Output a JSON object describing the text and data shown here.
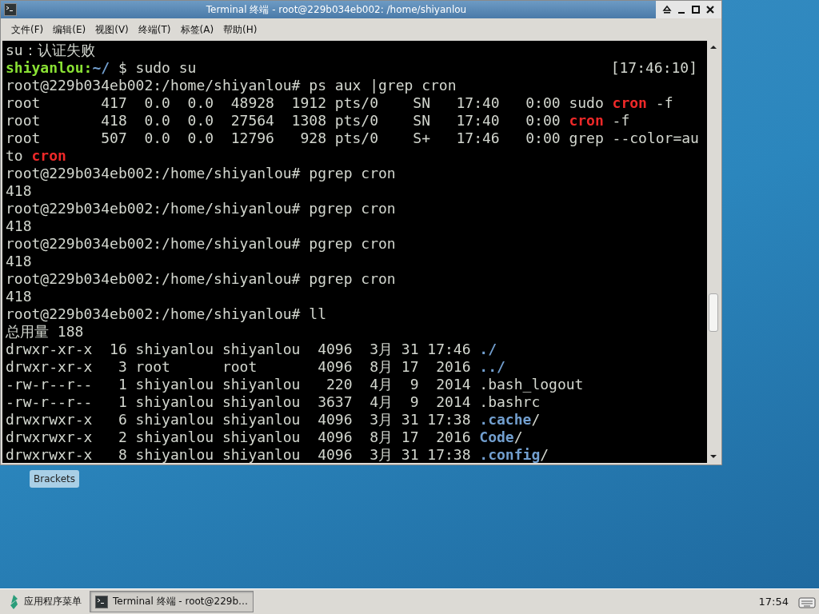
{
  "window": {
    "title": "Terminal 终端 - root@229b034eb002: /home/shiyanlou"
  },
  "menu": [
    "文件(F)",
    "编辑(E)",
    "视图(V)",
    "终端(T)",
    "标签(A)",
    "帮助(H)"
  ],
  "terminal": {
    "lines": [
      {
        "segments": [
          {
            "text": "su：认证失败",
            "kind": "plain"
          }
        ]
      },
      {
        "segments": [
          {
            "text": "shiyanlou:",
            "kind": "user"
          },
          {
            "text": "~/",
            "kind": "path"
          },
          {
            "text": " $ sudo su",
            "kind": "plain"
          }
        ],
        "right": "[17:46:10]"
      },
      {
        "segments": [
          {
            "text": "root@229b034eb002:/home/shiyanlou# ps aux |grep cron",
            "kind": "plain"
          }
        ]
      },
      {
        "segments": [
          {
            "text": "root       417  0.0  0.0  48928  1912 pts/0    SN   17:40   0:00 sudo ",
            "kind": "plain"
          },
          {
            "text": "cron",
            "kind": "match"
          },
          {
            "text": " -f",
            "kind": "plain"
          }
        ]
      },
      {
        "segments": [
          {
            "text": "root       418  0.0  0.0  27564  1308 pts/0    SN   17:40   0:00 ",
            "kind": "plain"
          },
          {
            "text": "cron",
            "kind": "match"
          },
          {
            "text": " -f",
            "kind": "plain"
          }
        ]
      },
      {
        "segments": [
          {
            "text": "root       507  0.0  0.0  12796   928 pts/0    S+   17:46   0:00 grep --color=au",
            "kind": "plain"
          }
        ]
      },
      {
        "segments": [
          {
            "text": "to ",
            "kind": "plain"
          },
          {
            "text": "cron",
            "kind": "match"
          }
        ]
      },
      {
        "segments": [
          {
            "text": "root@229b034eb002:/home/shiyanlou# pgrep cron",
            "kind": "plain"
          }
        ]
      },
      {
        "segments": [
          {
            "text": "418",
            "kind": "plain"
          }
        ]
      },
      {
        "segments": [
          {
            "text": "root@229b034eb002:/home/shiyanlou# pgrep cron",
            "kind": "plain"
          }
        ]
      },
      {
        "segments": [
          {
            "text": "418",
            "kind": "plain"
          }
        ]
      },
      {
        "segments": [
          {
            "text": "root@229b034eb002:/home/shiyanlou# pgrep cron",
            "kind": "plain"
          }
        ]
      },
      {
        "segments": [
          {
            "text": "418",
            "kind": "plain"
          }
        ]
      },
      {
        "segments": [
          {
            "text": "root@229b034eb002:/home/shiyanlou# pgrep cron",
            "kind": "plain"
          }
        ]
      },
      {
        "segments": [
          {
            "text": "418",
            "kind": "plain"
          }
        ]
      },
      {
        "segments": [
          {
            "text": "root@229b034eb002:/home/shiyanlou# ll",
            "kind": "plain"
          }
        ]
      },
      {
        "segments": [
          {
            "text": "总用量 188",
            "kind": "plain"
          }
        ]
      },
      {
        "segments": [
          {
            "text": "drwxr-xr-x  16 shiyanlou shiyanlou  4096  3月 31 17:46 ",
            "kind": "plain"
          },
          {
            "text": "./",
            "kind": "dir"
          }
        ]
      },
      {
        "segments": [
          {
            "text": "drwxr-xr-x   3 root      root       4096  8月 17  2016 ",
            "kind": "plain"
          },
          {
            "text": "../",
            "kind": "dir"
          }
        ]
      },
      {
        "segments": [
          {
            "text": "-rw-r--r--   1 shiyanlou shiyanlou   220  4月  9  2014 .bash_logout",
            "kind": "plain"
          }
        ]
      },
      {
        "segments": [
          {
            "text": "-rw-r--r--   1 shiyanlou shiyanlou  3637  4月  9  2014 .bashrc",
            "kind": "plain"
          }
        ]
      },
      {
        "segments": [
          {
            "text": "drwxrwxr-x   6 shiyanlou shiyanlou  4096  3月 31 17:38 ",
            "kind": "plain"
          },
          {
            "text": ".cache",
            "kind": "dir"
          },
          {
            "text": "/",
            "kind": "plain"
          }
        ]
      },
      {
        "segments": [
          {
            "text": "drwxrwxr-x   2 shiyanlou shiyanlou  4096  8月 17  2016 ",
            "kind": "plain"
          },
          {
            "text": "Code",
            "kind": "dir"
          },
          {
            "text": "/",
            "kind": "plain"
          }
        ]
      },
      {
        "segments": [
          {
            "text": "drwxrwxr-x   8 shiyanlou shiyanlou  4096  3月 31 17:38 ",
            "kind": "plain"
          },
          {
            "text": ".config",
            "kind": "dir"
          },
          {
            "text": "/",
            "kind": "plain"
          }
        ]
      }
    ]
  },
  "desktop_icons": [
    {
      "label": "Brackets"
    }
  ],
  "taskbar": {
    "app_menu": "应用程序菜单",
    "tasks": [
      {
        "label": "Terminal 终端 - root@229b…",
        "selected": true
      }
    ],
    "clock": "17:54"
  }
}
